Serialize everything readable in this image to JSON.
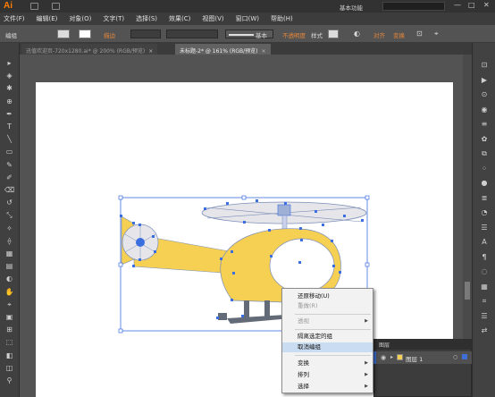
{
  "app": {
    "logo": "Ai",
    "workspace": "基本功能",
    "window_controls": [
      "—",
      "□",
      "✕"
    ]
  },
  "menu": [
    "文件(F)",
    "编辑(E)",
    "对象(O)",
    "文字(T)",
    "选择(S)",
    "效果(C)",
    "视图(V)",
    "窗口(W)",
    "帮助(H)"
  ],
  "control_bar": {
    "selection_label": "编组",
    "stroke_label": "描边",
    "stroke_style": "基本",
    "opacity_label": "不透明度",
    "style_label": "样式",
    "align_label": "对齐",
    "transform_label": "变换"
  },
  "tabs": [
    {
      "label": "迅值欢迎页-720x1280.ai* @ 200% (RGB/预览)",
      "active": false
    },
    {
      "label": "未标题-2* @ 161% (RGB/预览)",
      "active": true
    }
  ],
  "tab_close": "×",
  "tools_left": [
    "▸",
    "◈",
    "✱",
    "⊕",
    "✒",
    "T",
    "╲",
    "▭",
    "✎",
    "✐",
    "⌫",
    "↺",
    "⤡",
    "✧",
    "⟠",
    "▦",
    "▤",
    "◐",
    "✋",
    "⌖",
    "▣",
    "⊞",
    "⬚",
    "◧",
    "◫",
    "⚲"
  ],
  "tools_right": [
    "⊡",
    "▶",
    "⊙",
    "◉",
    "≡",
    "✿",
    "⧉",
    "⁘",
    "●",
    "≣",
    "◔",
    "☰",
    "A",
    "¶",
    "◌",
    "▦",
    "⌗",
    "☰",
    "⇄"
  ],
  "colors": {
    "helicopter_body": "#f5d053",
    "rotor": "#e6e6ea",
    "skid": "#646b78",
    "selection": "#3b6fe0",
    "menu_highlight": "#c9dcf1",
    "accent_orange": "#e8883a"
  },
  "layers_panel": {
    "tab": "图层",
    "layer_name": "图层 1"
  },
  "context_menu": {
    "items": [
      {
        "label": "还原移动(U)",
        "disabled": false,
        "submenu": false
      },
      {
        "label": "重做(R)",
        "disabled": true,
        "submenu": false
      },
      {
        "label": "透视",
        "disabled": true,
        "submenu": true
      },
      {
        "label": "隔离选定的组",
        "disabled": false,
        "submenu": false
      },
      {
        "label": "取消编组",
        "disabled": false,
        "submenu": false,
        "highlight": true
      },
      {
        "label": "变换",
        "disabled": false,
        "submenu": true
      },
      {
        "label": "排列",
        "disabled": false,
        "submenu": true
      },
      {
        "label": "选择",
        "disabled": false,
        "submenu": true
      }
    ]
  }
}
